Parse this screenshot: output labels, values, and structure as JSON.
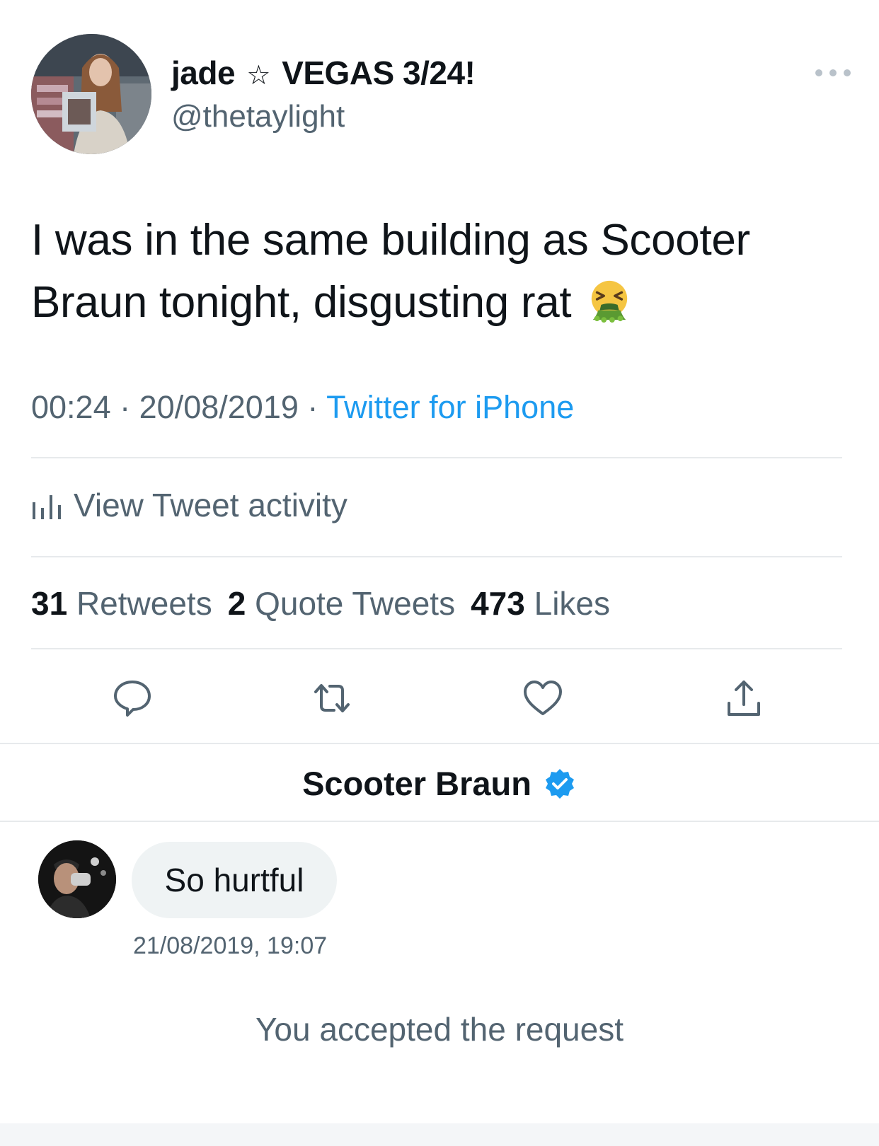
{
  "tweet": {
    "display_name_prefix": "jade",
    "display_name_star": "☆",
    "display_name_suffix": "VEGAS 3/24!",
    "handle": "@thetaylight",
    "text": "I was in the same building as Scooter Braun tonight, disgusting rat",
    "emoji": "vomiting-face",
    "time": "00:24",
    "date": "20/08/2019",
    "separator": "·",
    "source": "Twitter for iPhone",
    "activity_label": "View Tweet activity",
    "stats": {
      "retweets_count": "31",
      "retweets_label": "Retweets",
      "quotes_count": "2",
      "quotes_label": "Quote Tweets",
      "likes_count": "473",
      "likes_label": "Likes"
    },
    "actions": [
      "reply-icon",
      "retweet-icon",
      "like-icon",
      "share-icon"
    ]
  },
  "dm": {
    "name": "Scooter Braun",
    "verified": true,
    "message": "So hurtful",
    "timestamp": "21/08/2019, 19:07",
    "status": "You accepted the request"
  },
  "colors": {
    "text_primary": "#0f1419",
    "text_secondary": "#536471",
    "link": "#1d9bf0",
    "divider": "#e7eaec",
    "bubble": "#eff3f4"
  }
}
